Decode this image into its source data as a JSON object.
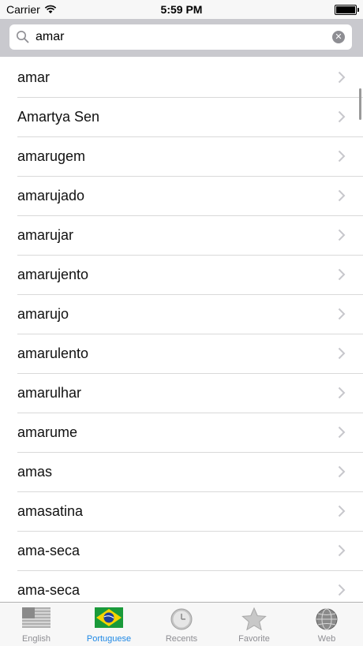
{
  "status_bar": {
    "carrier": "Carrier",
    "time": "5:59 PM"
  },
  "search": {
    "value": "amar"
  },
  "results": [
    "amar",
    "Amartya Sen",
    "amarugem",
    "amarujado",
    "amarujar",
    "amarujento",
    "amarujo",
    "amarulento",
    "amarulhar",
    "amarume",
    "amas",
    "amasatina",
    "ama-seca",
    "ama-seca"
  ],
  "tabs": [
    {
      "label": "English",
      "icon": "us-flag-icon",
      "active": false
    },
    {
      "label": "Portuguese",
      "icon": "brazil-flag-icon",
      "active": true
    },
    {
      "label": "Recents",
      "icon": "clock-icon",
      "active": false
    },
    {
      "label": "Favorite",
      "icon": "star-icon",
      "active": false
    },
    {
      "label": "Web",
      "icon": "globe-icon",
      "active": false
    }
  ],
  "colors": {
    "accent": "#1e88e5",
    "search_bg": "#c9c9ce",
    "inactive": "#8e8e93"
  }
}
